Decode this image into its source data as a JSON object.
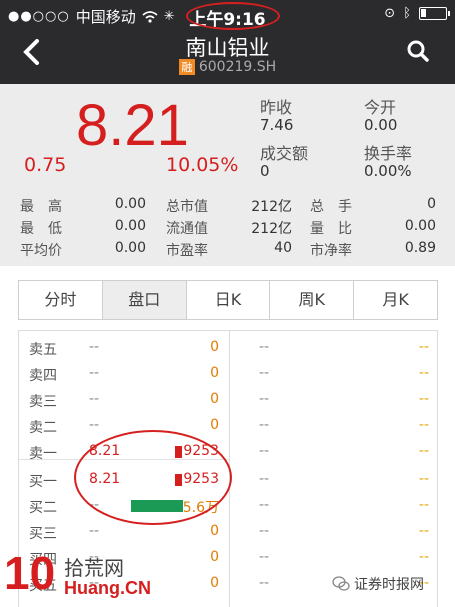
{
  "status": {
    "carrier": "中国移动",
    "dots": "●●○○○",
    "time": "上午9:16"
  },
  "header": {
    "title": "南山铝业",
    "badge": "融",
    "code": "600219.SH"
  },
  "quote": {
    "price": "8.21",
    "change": "0.75",
    "change_pct": "10.05%",
    "stats": [
      {
        "label": "昨收",
        "value": "7.46"
      },
      {
        "label": "今开",
        "value": "0.00"
      },
      {
        "label": "成交额",
        "value": "0"
      },
      {
        "label": "换手率",
        "value": "0.00%"
      }
    ],
    "grid": [
      {
        "l1": "最　高",
        "v1": "0.00",
        "l2": "总市值",
        "v2": "212亿",
        "l3": "总　手",
        "v3": "0"
      },
      {
        "l1": "最　低",
        "v1": "0.00",
        "l2": "流通值",
        "v2": "212亿",
        "l3": "量　比",
        "v3": "0.00"
      },
      {
        "l1": "平均价",
        "v1": "0.00",
        "l2": "市盈率",
        "v2": "40",
        "l3": "市净率",
        "v3": "0.89"
      }
    ]
  },
  "tabs": [
    "分时",
    "盘口",
    "日K",
    "周K",
    "月K"
  ],
  "book": {
    "rows": [
      {
        "label": "卖五",
        "price": "--",
        "volume": "0"
      },
      {
        "label": "卖四",
        "price": "--",
        "volume": "0"
      },
      {
        "label": "卖三",
        "price": "--",
        "volume": "0"
      },
      {
        "label": "卖二",
        "price": "--",
        "volume": "0"
      },
      {
        "label": "卖一",
        "price": "8.21",
        "volume": "9253"
      },
      {
        "label": "买一",
        "price": "8.21",
        "volume": "9253"
      },
      {
        "label": "买二",
        "price": "--",
        "volume": "5.6万"
      },
      {
        "label": "买三",
        "price": "--",
        "volume": "0"
      },
      {
        "label": "买四",
        "price": "--",
        "volume": "0"
      },
      {
        "label": "买五",
        "price": "--",
        "volume": "0"
      }
    ],
    "right_placeholder": "--"
  },
  "watermark": {
    "left_num": "10",
    "left_cn": "拾荒网",
    "left_url": "Huang.CN",
    "right": "证券时报网"
  },
  "colors": {
    "up_red": "#d51f1f",
    "header_bg": "#2b2b2d",
    "panel_bg": "#ececec",
    "volume_orange": "#e07b00",
    "buy_bar_green": "#1a9a55"
  }
}
